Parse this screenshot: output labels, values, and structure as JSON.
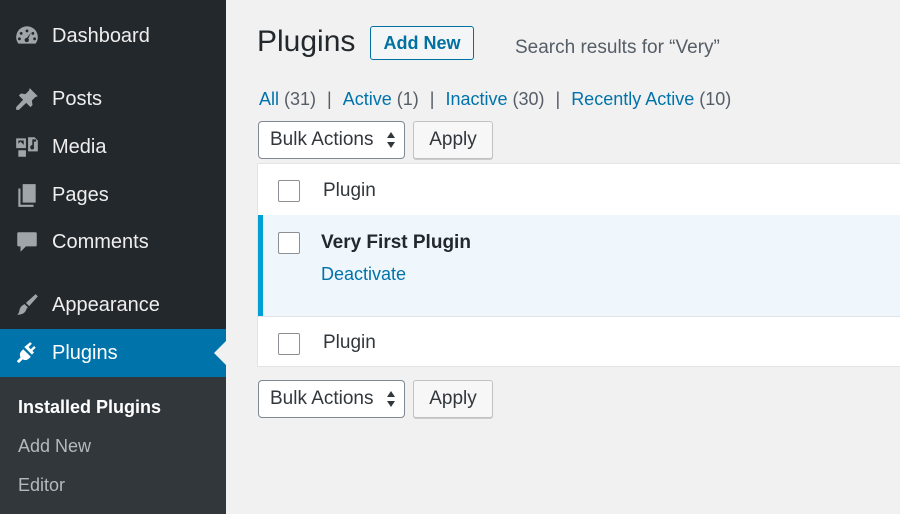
{
  "sidebar": {
    "items": [
      {
        "label": "Dashboard",
        "icon": "dashboard-icon"
      },
      {
        "label": "Posts",
        "icon": "pin-icon"
      },
      {
        "label": "Media",
        "icon": "media-icon"
      },
      {
        "label": "Pages",
        "icon": "pages-icon"
      },
      {
        "label": "Comments",
        "icon": "comment-icon"
      },
      {
        "label": "Appearance",
        "icon": "brush-icon"
      },
      {
        "label": "Plugins",
        "icon": "plugin-icon",
        "current": true
      }
    ],
    "submenu": [
      {
        "label": "Installed Plugins",
        "current": true
      },
      {
        "label": "Add New"
      },
      {
        "label": "Editor"
      }
    ]
  },
  "header": {
    "title": "Plugins",
    "add_new_label": "Add New",
    "search_results": "Search results for “Very”"
  },
  "filters": [
    {
      "label": "All",
      "count": "(31)"
    },
    {
      "label": "Active",
      "count": "(1)"
    },
    {
      "label": "Inactive",
      "count": "(30)"
    },
    {
      "label": "Recently Active",
      "count": "(10)"
    }
  ],
  "filter_separator": "|",
  "bulk_actions": {
    "selected": "Bulk Actions",
    "apply_label": "Apply"
  },
  "table": {
    "header_column": "Plugin",
    "footer_column": "Plugin",
    "rows": [
      {
        "name": "Very First Plugin",
        "action": "Deactivate",
        "active": true
      }
    ]
  },
  "colors": {
    "sidebar_bg": "#23282d",
    "submenu_bg": "#32373c",
    "accent": "#0073aa",
    "active_row_bg": "#f0f7fc",
    "active_row_border": "#00a0d2",
    "page_bg": "#f1f1f1"
  }
}
